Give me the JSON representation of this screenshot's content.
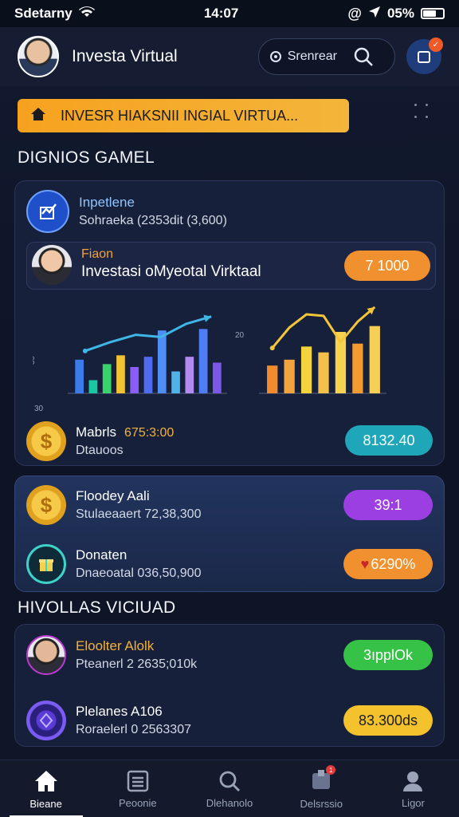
{
  "status_bar": {
    "carrier": "Sdetarny",
    "time": "14:07",
    "battery": "05%"
  },
  "header": {
    "title": "Investa Virtual",
    "search_label": "Srenrear"
  },
  "banner": {
    "text": "INVESR HIAKSNII INGIAL VIRTUA..."
  },
  "section1": {
    "title": "DIGNIOS GAMEL"
  },
  "card1": {
    "top_row": {
      "title": "Inpetlene",
      "subtitle": "Sohraeka (2353dit (3,600)"
    },
    "inner": {
      "line1": "Fiaon",
      "line2": "Investasi oMyeotal Virktaal",
      "pill": "7 1000"
    },
    "chart_ticks": {
      "left_top": "30",
      "left_bottom": "30",
      "right_top": "20"
    },
    "bottom_row": {
      "title": "Mabrls",
      "amount": "675:3:00",
      "subtitle": "Dtauoos",
      "pill": "8132.40"
    }
  },
  "card2": {
    "row1": {
      "title": "Floodey Aali",
      "subtitle": "Stulaeaaert 72,38,300",
      "pill": "39:1"
    },
    "row2": {
      "title": "Donaten",
      "subtitle": "Dnaeoatal 036,50,900",
      "pill": "6290%"
    }
  },
  "section2": {
    "title": "HIVOLLAS VICIUAD"
  },
  "card3": {
    "row1": {
      "title": "Eloolter Alolk",
      "subtitle": "Pteanerl 2 2635;010k",
      "pill": "3ıpplOk"
    },
    "row2": {
      "title": "Plelanes A106",
      "subtitle": "Roraelerl 0 2563307",
      "pill": "83.300ds"
    }
  },
  "tabs": [
    "Bieane",
    "Peoonie",
    "Dlehanolo",
    "Delsrssio",
    "Ligor"
  ],
  "chart_data": [
    {
      "type": "bar",
      "title": "",
      "series": [
        {
          "values": [
            46,
            18,
            40,
            52,
            36,
            50,
            86,
            30,
            50,
            88,
            42
          ]
        }
      ],
      "line_values": [
        58,
        70,
        80,
        77,
        95,
        105
      ],
      "colors": [
        "#3b7bea",
        "#19c7a4",
        "#39d36b",
        "#f1c232",
        "#8b5cf6",
        "#4f6bf0",
        "#4f8df7",
        "#4fb2e8",
        "#b38bf0",
        "#4f7df6",
        "#7c58e8"
      ],
      "line_color": "#3fb6e6"
    },
    {
      "type": "bar",
      "title": "",
      "series": [
        {
          "values": [
            38,
            46,
            64,
            56,
            84,
            68,
            92
          ]
        }
      ],
      "line_values": [
        62,
        90,
        108,
        106,
        70,
        98,
        118
      ],
      "colors": [
        "#f28a2e",
        "#f2a53c",
        "#f5d33f",
        "#f5c04a",
        "#f7d251",
        "#f49a33",
        "#f6cf55"
      ],
      "line_color": "#f3c63a"
    }
  ],
  "colors": {
    "accent_orange": "#f6a21f",
    "pill_orange": "#f0902e",
    "pill_teal": "#1fa7b9",
    "pill_purple": "#9b3fe3",
    "pill_green": "#35c246",
    "pill_yellow": "#f3c22d"
  }
}
